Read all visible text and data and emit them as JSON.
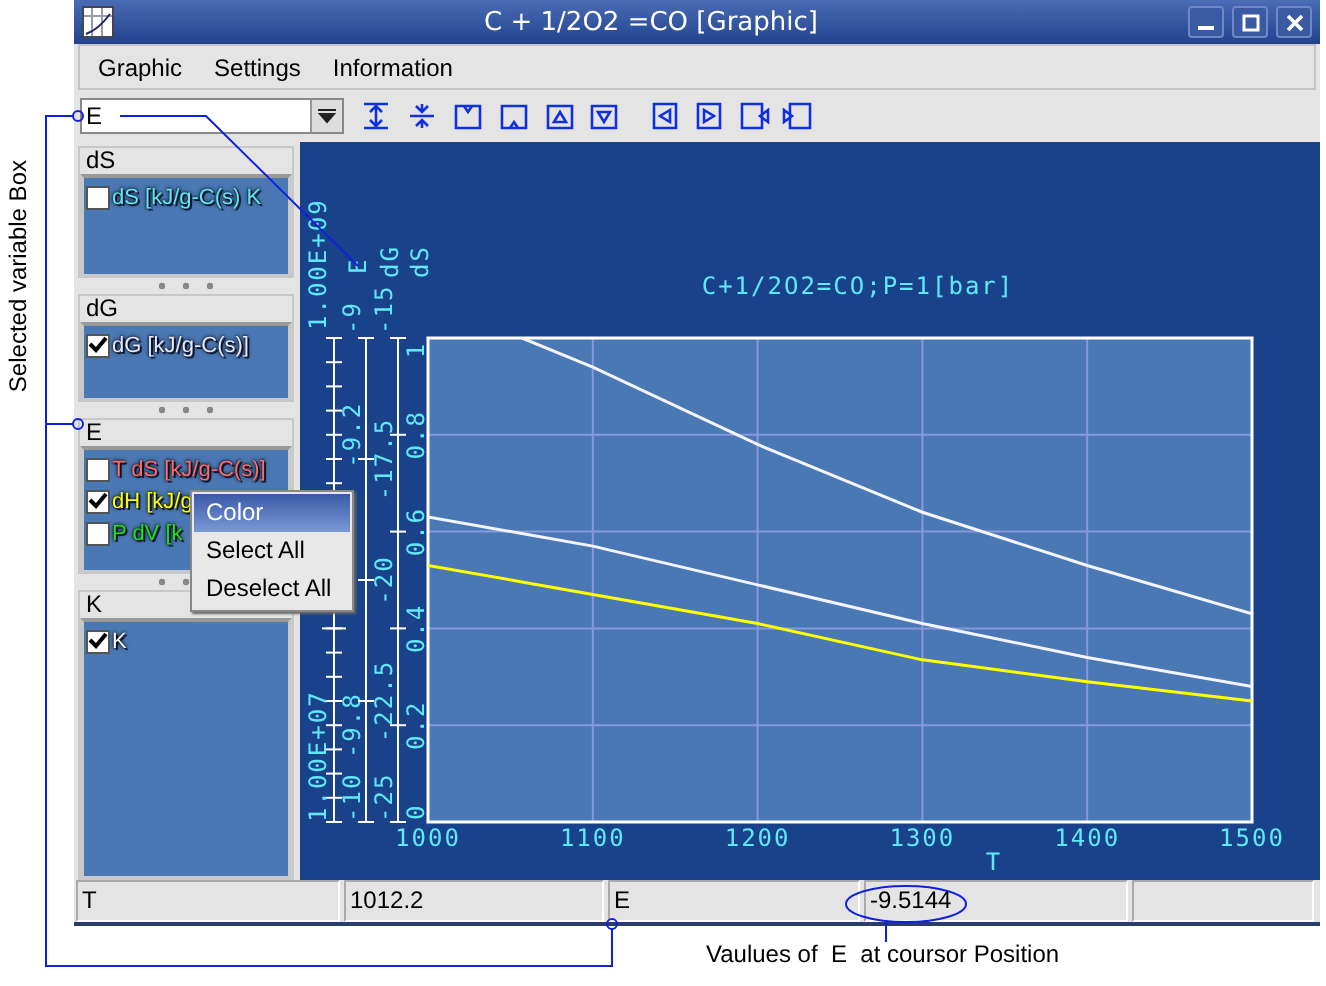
{
  "annotations": {
    "side_label": "Selected variable Box",
    "bottom_label": "Vaulues of  E  at coursor Position"
  },
  "window": {
    "title": "C + 1/2O2 =CO [Graphic]"
  },
  "menu": [
    "Graphic",
    "Settings",
    "Information"
  ],
  "toolbar": {
    "variable": "E"
  },
  "groups": [
    {
      "title": "dS",
      "items": [
        {
          "label": "dS [kJ/g-C(s) K",
          "checked": false,
          "color": "#60e8f8"
        }
      ]
    },
    {
      "title": "dG",
      "items": [
        {
          "label": "dG [kJ/g-C(s)]",
          "checked": true,
          "color": "#e8e8ff"
        }
      ]
    },
    {
      "title": "E",
      "items": [
        {
          "label": "T dS [kJ/g-C(s)]",
          "checked": false,
          "color": "#ff6a6a"
        },
        {
          "label": "dH [kJ/g",
          "checked": true,
          "color": "#ffff00"
        },
        {
          "label": "P dV [k",
          "checked": false,
          "color": "#20e020"
        }
      ]
    },
    {
      "title": "K",
      "items": [
        {
          "label": "K",
          "checked": true,
          "color": "#ffffff"
        }
      ]
    }
  ],
  "context_menu": [
    {
      "label": "Color",
      "selected": true
    },
    {
      "label": "Select All",
      "selected": false
    },
    {
      "label": "Deselect All",
      "selected": false
    }
  ],
  "chart": {
    "extra_axes": [
      {
        "title": "E",
        "ticks": [
          {
            "kind": "labeled",
            "label": "-9"
          },
          {
            "kind": "labeled",
            "label": "-9.2"
          },
          {
            "kind": "unlabeled"
          },
          {
            "kind": "unlabeled"
          },
          {
            "kind": "labeled",
            "label": "-9.8"
          },
          {
            "kind": "labeled",
            "label": "-10"
          }
        ]
      },
      {
        "title": "dG",
        "ticks": [
          {
            "kind": "labeled",
            "label": "-15"
          },
          {
            "kind": "labeled",
            "label": "-17.5"
          },
          {
            "kind": "labeled",
            "label": "-20"
          },
          {
            "kind": "labeled",
            "label": "-22.5"
          },
          {
            "kind": "labeled",
            "label": "-25"
          }
        ]
      }
    ],
    "k_labels": [
      "1.00E+09",
      "1.00E+07"
    ],
    "chart_data": {
      "type": "line",
      "grid": true,
      "title": "C+1/2O2=CO;P=1[bar]",
      "xlabel": "T",
      "ylabel": "dS",
      "x": [
        1000,
        1057,
        1100,
        1200,
        1300,
        1400,
        1500
      ],
      "xlim": [
        1000,
        1500
      ],
      "ylim": [
        0,
        1
      ],
      "xticks": [
        1000,
        1100,
        1200,
        1300,
        1400,
        1500
      ],
      "yticks": [
        {
          "value": 0,
          "label": "0"
        },
        {
          "value": 0.2,
          "label": "0.2"
        },
        {
          "value": 0.4,
          "label": "0.4"
        },
        {
          "value": 0.6,
          "label": "0.6"
        },
        {
          "value": 0.8,
          "label": "0.8"
        },
        {
          "value": 1,
          "label": "1"
        }
      ],
      "series": [
        {
          "color": "#f4f4ff",
          "values": [
            null,
            1,
            0.94,
            0.78,
            0.64,
            0.53,
            0.43
          ]
        },
        {
          "color": "#f4f4ff",
          "values": [
            0.63,
            0.596,
            0.57,
            0.49,
            0.41,
            0.34,
            0.28
          ]
        },
        {
          "color": "#ffff00",
          "values": [
            0.53,
            0.496,
            0.47,
            0.41,
            0.335,
            0.29,
            0.25
          ]
        }
      ]
    }
  },
  "status_bar": [
    "T",
    "1012.2",
    "E",
    "-9.5144"
  ]
}
